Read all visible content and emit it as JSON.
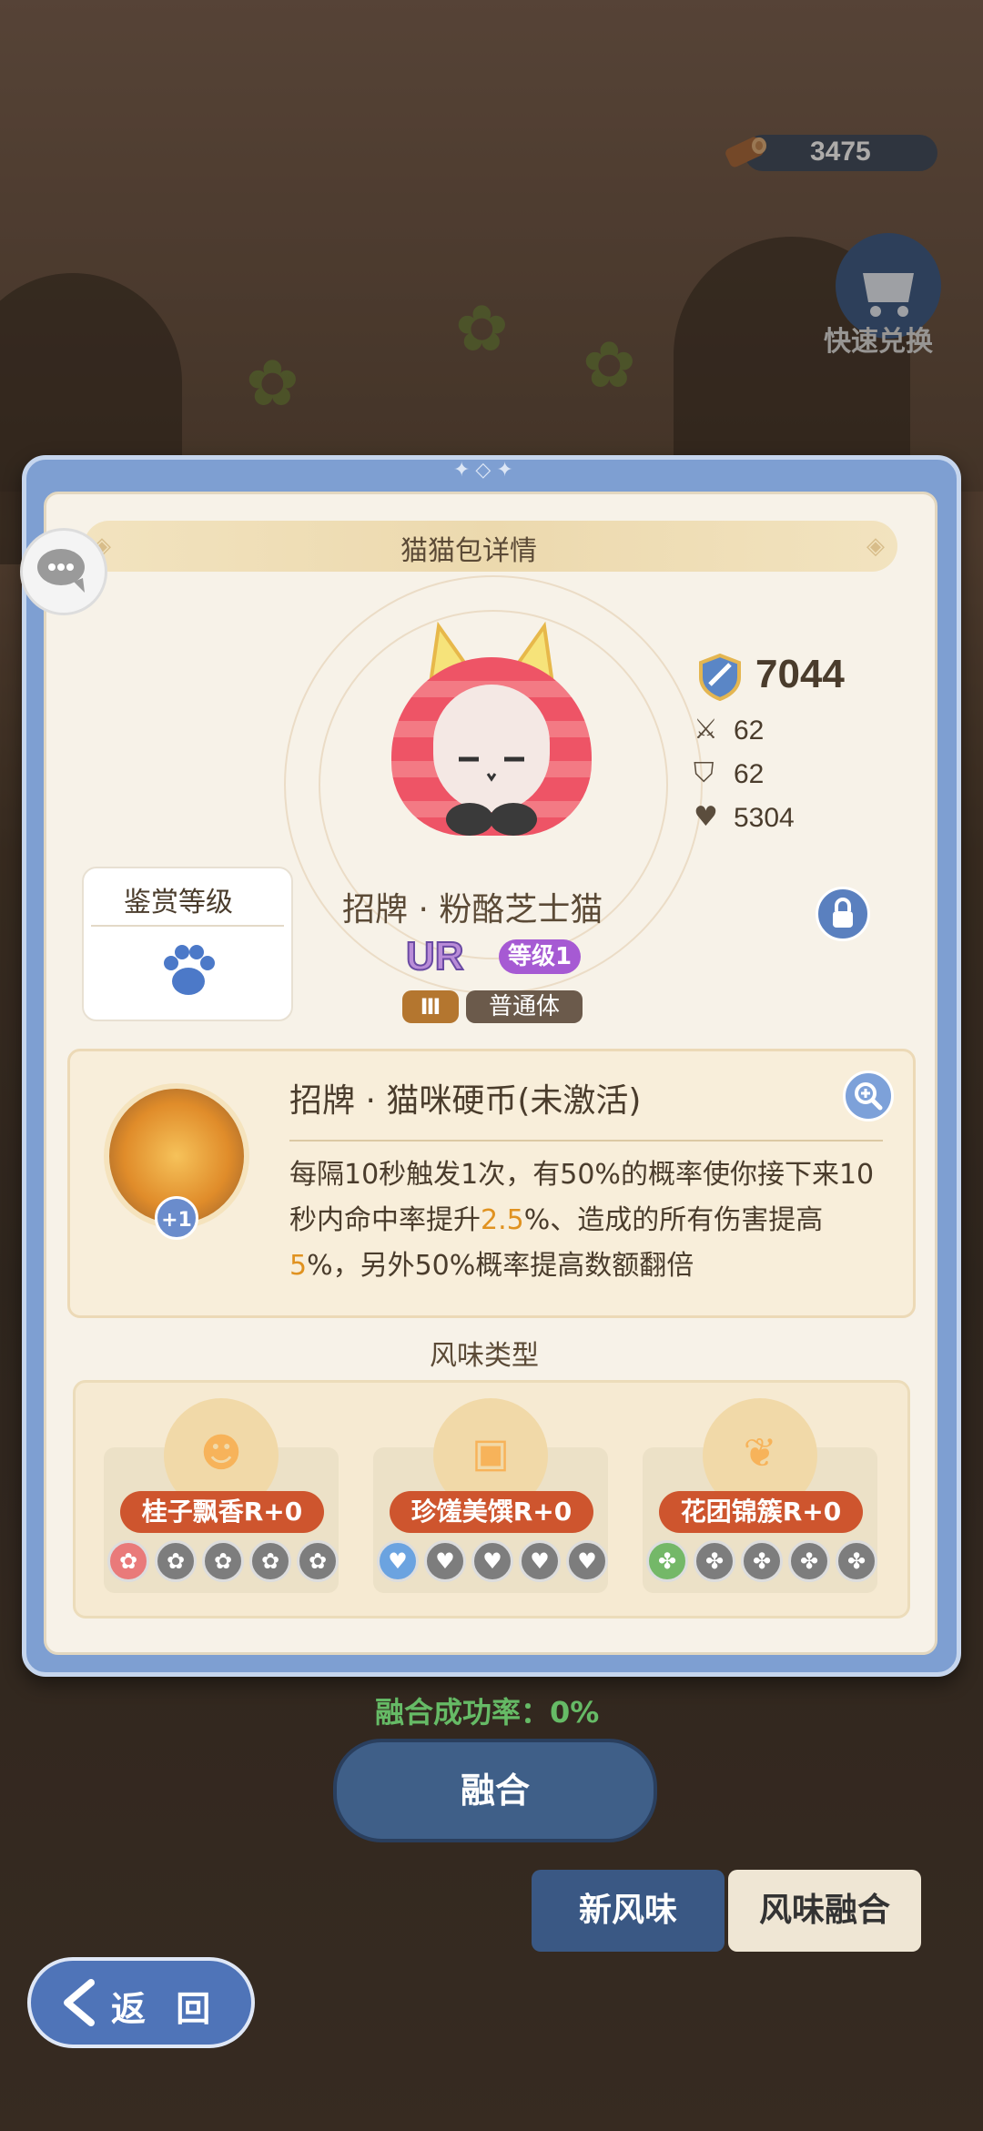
{
  "resources": {
    "wood_value": "3475",
    "wood_icon": "log-icon"
  },
  "quick_exchange": {
    "label": "快速兑换",
    "icon": "cart-icon"
  },
  "background_ui": {
    "fusion_rate_label": "融合成功率：0%",
    "fuse_button": "融合",
    "tab_new_flavor": "新风味",
    "tab_flavor_fusion": "风味融合",
    "back_button": "返 回"
  },
  "modal": {
    "title": "猫猫包详情",
    "appraisal": {
      "label": "鉴赏等级",
      "icon": "paw-icon"
    },
    "cat": {
      "name": "招牌 · 粉酪芝士猫",
      "rarity": "UR",
      "level": "等级1",
      "tier": "Ⅲ",
      "body_type": "普通体"
    },
    "stats": {
      "power": "7044",
      "attack": "62",
      "defense": "62",
      "hp": "5304"
    },
    "skill": {
      "title": "招牌 · 猫咪硬币(未激活)",
      "badge": "+1",
      "desc_part1": "每隔10秒触发1次，有50%的概率使你接下来10秒内命中率提升",
      "desc_hl1": "2.5",
      "desc_part2": "%、造成的所有伤害提高",
      "desc_hl2": "5",
      "desc_part3": "%，另外50%概率提高数额翻倍"
    },
    "flavor": {
      "section_title": "风味类型",
      "items": [
        {
          "label": "桂子飘香R+0",
          "icon": "cat-face-icon"
        },
        {
          "label": "珍馐美馔R+0",
          "icon": "dish-icon"
        },
        {
          "label": "花团锦簇R+0",
          "icon": "fox-tail-icon"
        }
      ]
    }
  },
  "colors": {
    "modal_frame": "#7e9fd2",
    "panel": "#f7f2e8",
    "flavor_label": "#ce552e",
    "highlight": "#e09220",
    "level_badge": "#a65ad3"
  }
}
